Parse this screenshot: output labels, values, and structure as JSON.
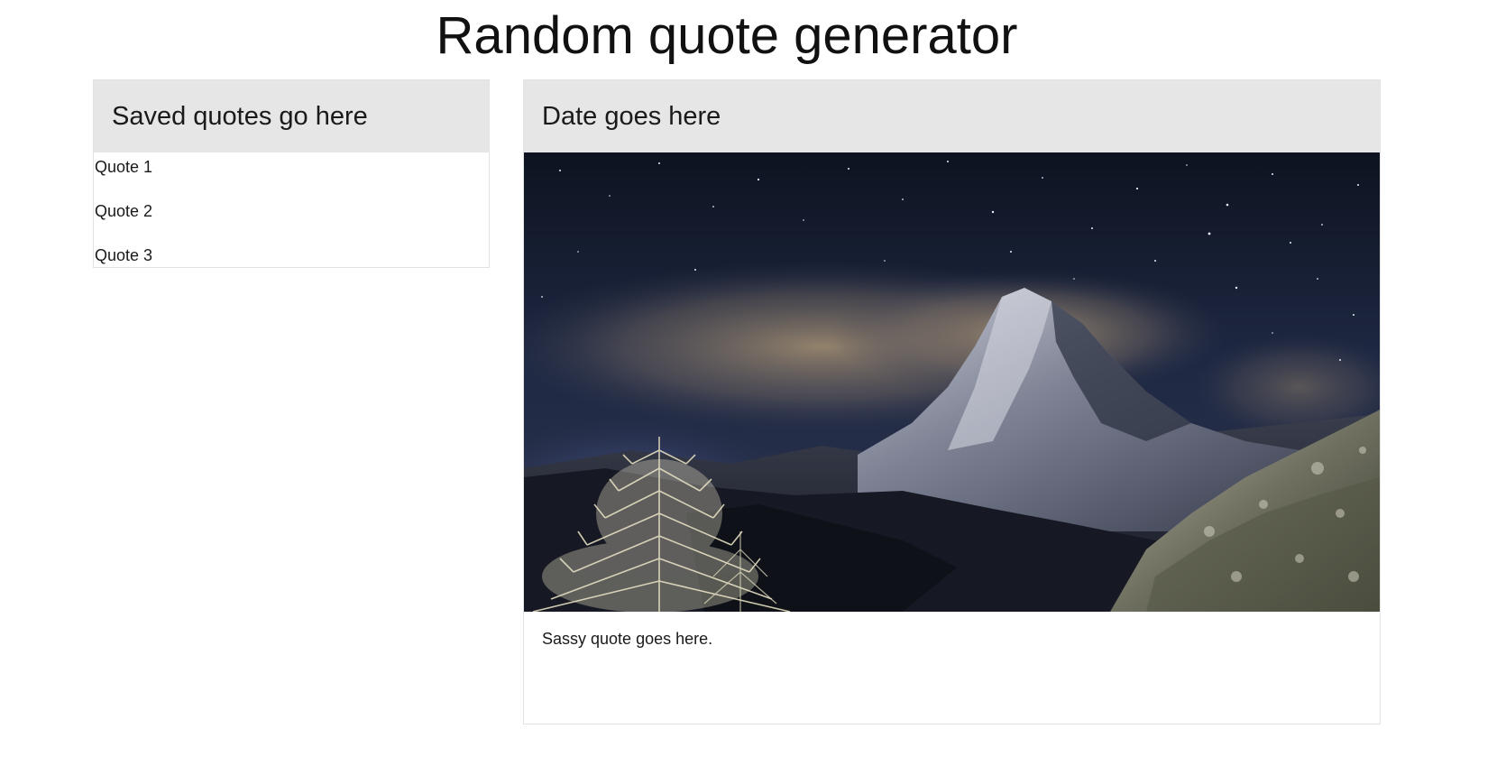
{
  "page": {
    "title": "Random quote generator"
  },
  "saved": {
    "header": "Saved quotes go here",
    "quotes": [
      "Quote 1",
      "Quote 2",
      "Quote 3"
    ]
  },
  "main": {
    "header": "Date goes here",
    "image_subject": "starry night sky over a snowy mountain peak with frosted tree",
    "quote": "Sassy quote goes here."
  },
  "colors": {
    "header_bg": "#e6e6e6",
    "card_border": "#e2e2e2",
    "text": "#1a1a1a"
  }
}
